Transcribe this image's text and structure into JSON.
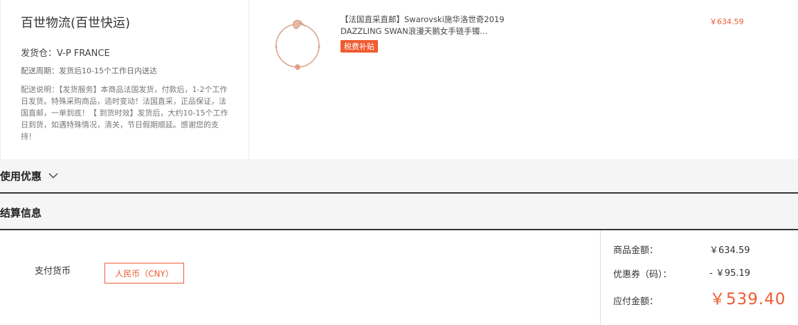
{
  "shipping": {
    "title": "百世物流(百世快运)",
    "warehouse": "发货仓：V-P FRANCE",
    "period": "配送周期：发货后10-15个工作日内送达",
    "note": "配送说明：【发货服务】本商品法国发货，付款后，1-2个工作日发货。特殊采购商品，适时变动！法国直采，正品保证，法国直邮，一单到底！【 到货时效】发货后，大约10-15个工作日到货，如遇特殊情况，清关，节日假期顺延。感谢您的支持！"
  },
  "product": {
    "title": "【法国直采直邮】Swarovski施华洛世奇2019 DAZZLING SWAN浪漫天鹅女手链手镯...",
    "badge": "税费补贴",
    "price": "￥634.59",
    "image_icon": "bracelet-image"
  },
  "sections": {
    "coupon": "使用优惠",
    "settlement": "结算信息"
  },
  "payment": {
    "currency_label": "支付货币",
    "currency_value": "人民币（CNY）"
  },
  "summary": {
    "goods_label": "商品金额：",
    "goods_value": "￥634.59",
    "coupon_label": "优惠券（码）：",
    "coupon_value": "- ￥95.19",
    "payable_label": "应付金额：",
    "payable_value": "￥539.40"
  },
  "colors": {
    "accent": "#ef5b30",
    "section_bg": "#f5f5f5"
  }
}
